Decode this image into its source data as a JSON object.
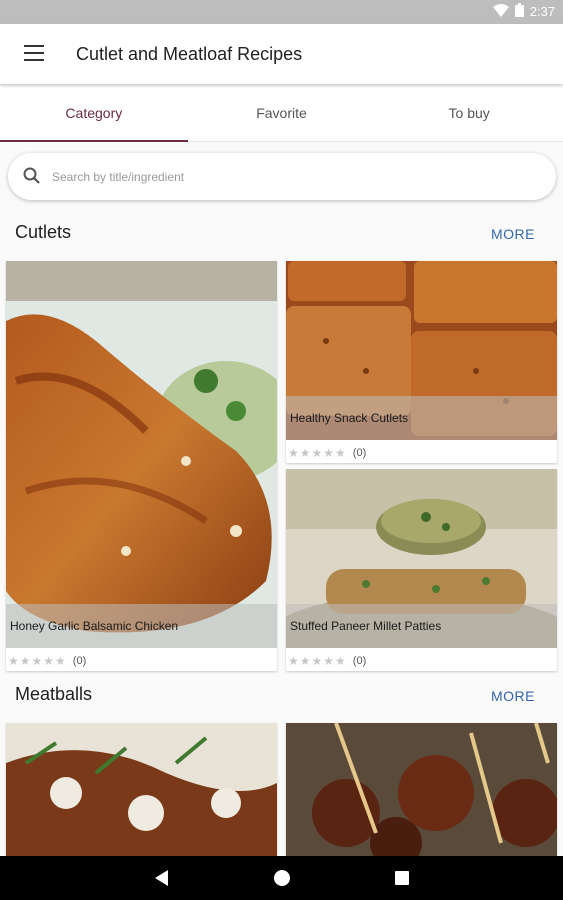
{
  "status": {
    "time": "2:37"
  },
  "appbar": {
    "title": "Cutlet and Meatloaf Recipes"
  },
  "tabs": [
    {
      "label": "Category",
      "active": true
    },
    {
      "label": "Favorite",
      "active": false
    },
    {
      "label": "To buy",
      "active": false
    }
  ],
  "search": {
    "placeholder": "Search by title/ingredient",
    "value": ""
  },
  "sections": [
    {
      "title": "Cutlets",
      "more": "MORE",
      "cards": [
        {
          "title": "Honey Garlic Balsamic Chicken",
          "rating_count": "(0)",
          "stars": 0
        },
        {
          "title": "Healthy Snack Cutlets",
          "rating_count": "(0)",
          "stars": 0
        },
        {
          "title": "Stuffed Paneer Millet Patties",
          "rating_count": "(0)",
          "stars": 0
        }
      ]
    },
    {
      "title": "Meatballs",
      "more": "MORE",
      "cards": []
    }
  ],
  "colors": {
    "accent": "#6a2b44",
    "link": "#3366aa"
  }
}
